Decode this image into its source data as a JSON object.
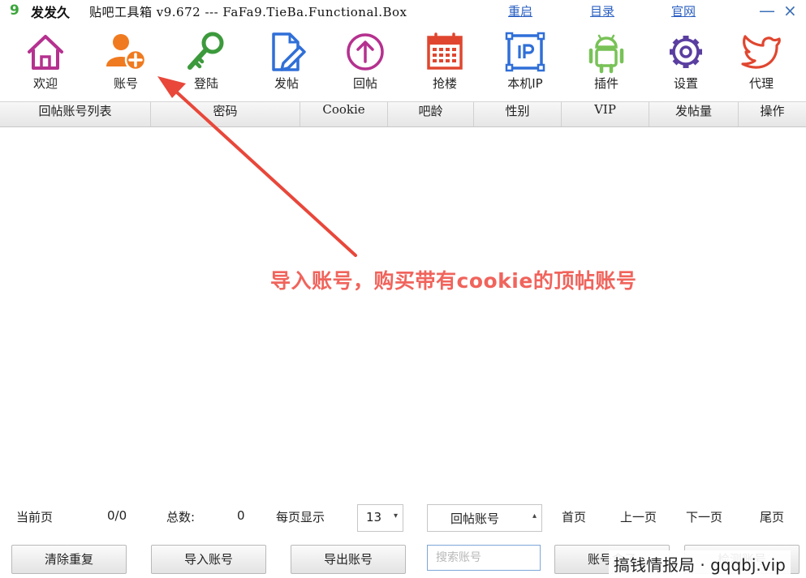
{
  "titlebar": {
    "logo": "9",
    "app_name": "发发久",
    "subtitle": "贴吧工具箱 v9.672 --- FaFa9.TieBa.Functional.Box",
    "links": [
      "重启",
      "目录",
      "官网"
    ],
    "minimize": "—",
    "close": "×"
  },
  "toolbar": {
    "items": [
      {
        "label": "欢迎",
        "icon": "home-icon",
        "color": "#b5318f"
      },
      {
        "label": "账号",
        "icon": "add-user-icon",
        "color": "#f07a1f"
      },
      {
        "label": "登陆",
        "icon": "key-icon",
        "color": "#3c9a3c"
      },
      {
        "label": "发帖",
        "icon": "edit-document-icon",
        "color": "#2f6fd8"
      },
      {
        "label": "回帖",
        "icon": "upload-circle-icon",
        "color": "#b5318f"
      },
      {
        "label": "抢楼",
        "icon": "calendar-icon",
        "color": "#e0462f"
      },
      {
        "label": "本机IP",
        "icon": "ip-icon",
        "color": "#2f6fd8"
      },
      {
        "label": "插件",
        "icon": "android-icon",
        "color": "#78c257"
      },
      {
        "label": "设置",
        "icon": "gear-icon",
        "color": "#5a3ea0"
      },
      {
        "label": "代理",
        "icon": "bird-icon",
        "color": "#e0462f"
      }
    ]
  },
  "table": {
    "columns": [
      "回帖账号列表",
      "密码",
      "Cookie",
      "吧龄",
      "性别",
      "VIP",
      "发帖量",
      "操作"
    ]
  },
  "annotation": {
    "text": "导入账号，购买带有cookie的顶帖账号",
    "color": "#f0645c"
  },
  "pager": {
    "current_label": "当前页",
    "current_value": "0/0",
    "total_label": "总数:",
    "total_value": "0",
    "per_page_label": "每页显示",
    "per_page_value": "13",
    "list_type": "回帖账号",
    "first": "首页",
    "prev": "上一页",
    "next": "下一页",
    "last": "尾页"
  },
  "actions": {
    "clear_duplicates": "清除重复",
    "import": "导入账号",
    "export": "导出账号",
    "search_placeholder": "搜索账号",
    "account_box": "账号盒子",
    "check": "检测账号"
  },
  "watermark": "搞钱情报局 · gqqbj.vip"
}
